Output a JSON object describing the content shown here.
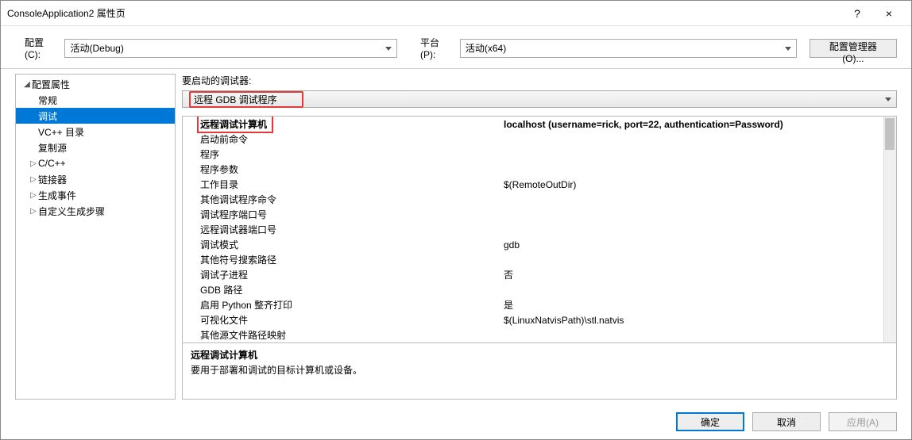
{
  "titlebar": {
    "title": "ConsoleApplication2 属性页",
    "help": "?",
    "close": "×"
  },
  "configRow": {
    "configLabel": "配置(C):",
    "configValue": "活动(Debug)",
    "platformLabel": "平台(P):",
    "platformValue": "活动(x64)",
    "managerBtn": "配置管理器(O)..."
  },
  "sidebar": {
    "root": "配置属性",
    "items": [
      {
        "label": "常规"
      },
      {
        "label": "调试",
        "selected": true
      },
      {
        "label": "VC++ 目录"
      },
      {
        "label": "复制源"
      },
      {
        "label": "C/C++",
        "expandable": true
      },
      {
        "label": "链接器",
        "expandable": true
      },
      {
        "label": "生成事件",
        "expandable": true
      },
      {
        "label": "自定义生成步骤",
        "expandable": true
      }
    ]
  },
  "debugger": {
    "label": "要启动的调试器:",
    "selected": "远程 GDB 调试程序"
  },
  "props": [
    {
      "name": "远程调试计算机",
      "value": "localhost (username=rick, port=22, authentication=Password)",
      "highlight": true,
      "bold": true
    },
    {
      "name": "启动前命令",
      "value": ""
    },
    {
      "name": "程序",
      "value": ""
    },
    {
      "name": "程序参数",
      "value": ""
    },
    {
      "name": "工作目录",
      "value": "$(RemoteOutDir)"
    },
    {
      "name": "其他调试程序命令",
      "value": ""
    },
    {
      "name": "调试程序端口号",
      "value": ""
    },
    {
      "name": "远程调试器端口号",
      "value": ""
    },
    {
      "name": "调试模式",
      "value": "gdb"
    },
    {
      "name": "其他符号搜索路径",
      "value": ""
    },
    {
      "name": "调试子进程",
      "value": "否"
    },
    {
      "name": "GDB 路径",
      "value": ""
    },
    {
      "name": "启用 Python 整齐打印",
      "value": "是"
    },
    {
      "name": "可视化文件",
      "value": "$(LinuxNatvisPath)\\stl.natvis"
    },
    {
      "name": "其他源文件路径映射",
      "value": ""
    }
  ],
  "desc": {
    "title": "远程调试计算机",
    "text": "要用于部署和调试的目标计算机或设备。"
  },
  "footer": {
    "ok": "确定",
    "cancel": "取消",
    "apply": "应用(A)"
  }
}
